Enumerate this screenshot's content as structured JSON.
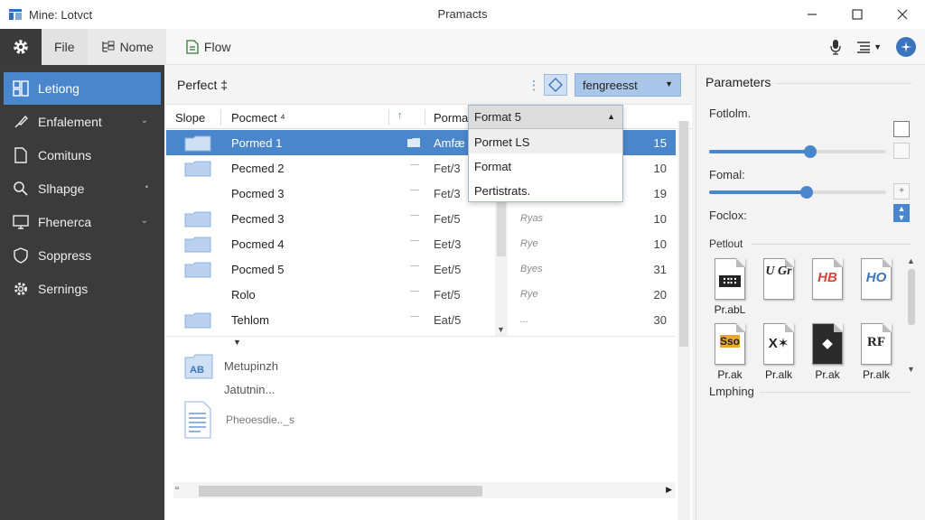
{
  "window": {
    "app_title": "Mine: Lotvct",
    "center_title": "Pramacts"
  },
  "toolbar": {
    "tabs": [
      {
        "label": "File"
      },
      {
        "label": "Nome"
      },
      {
        "label": "Flow"
      }
    ]
  },
  "sidebar": {
    "items": [
      {
        "label": "Letiong"
      },
      {
        "label": "Enfalement"
      },
      {
        "label": "Comituns"
      },
      {
        "label": "Slhapge"
      },
      {
        "label": "Fhenerca"
      },
      {
        "label": "Soppress"
      },
      {
        "label": "Sernings"
      }
    ]
  },
  "main": {
    "title": "Perfect",
    "title_suffix": "‡",
    "select_value": "fengreesst",
    "columns": {
      "c1": "Slope",
      "c2": "Pocmect ⁴",
      "c3": "Porma",
      "c3_arrow": "↑"
    },
    "rows": [
      {
        "name": "Pormed 1",
        "format": "Amfæ",
        "type": "",
        "num": "15",
        "selected": true
      },
      {
        "name": "Pecmed 2",
        "format": "Fet/3",
        "type": "",
        "num": "10"
      },
      {
        "name": "Pocmed 3",
        "format": "Fet/3",
        "type": "",
        "num": "19"
      },
      {
        "name": "Pecmed 3",
        "format": "Fet/5",
        "type": "Ryas",
        "num": "10"
      },
      {
        "name": "Pocmed 4",
        "format": "Eet/3",
        "type": "Rye",
        "num": "10"
      },
      {
        "name": "Pocmed 5",
        "format": "Eet/5",
        "type": "Byes",
        "num": "31"
      },
      {
        "name": "Rolo",
        "format": "Fet/5",
        "type": "Rye",
        "num": "20"
      },
      {
        "name": "Tehlom",
        "format": "Eat/5",
        "type": "...",
        "num": "30"
      }
    ],
    "lower_items": [
      {
        "label": "Metupinzh"
      },
      {
        "label": "Jatutnin..."
      },
      {
        "label": "Pheoesdie.._s"
      }
    ]
  },
  "dropdown": {
    "header": "Format 5",
    "options": [
      "Pormet LS",
      "Format",
      "Pertistrats."
    ]
  },
  "params": {
    "title": "Parameters",
    "fields": [
      {
        "label": "Fotlolm.",
        "value": 0.57
      },
      {
        "label": "Fomal:",
        "value": 0.55
      },
      {
        "label": "Foclox:"
      }
    ],
    "section": "Petlout",
    "tiles": [
      {
        "label": "Pr.abL",
        "glyph": "∷∷"
      },
      {
        "label": "",
        "glyph": "U Gr"
      },
      {
        "label": "",
        "glyph": "HB"
      },
      {
        "label": "",
        "glyph": "HO"
      },
      {
        "label": "Pr.ak",
        "glyph": "Sso"
      },
      {
        "label": "Pr.alk",
        "glyph": "X✶"
      },
      {
        "label": "Pr.ak",
        "glyph": "◆"
      },
      {
        "label": "Pr.alk",
        "glyph": "RF"
      }
    ],
    "footer": "Lmphing"
  }
}
